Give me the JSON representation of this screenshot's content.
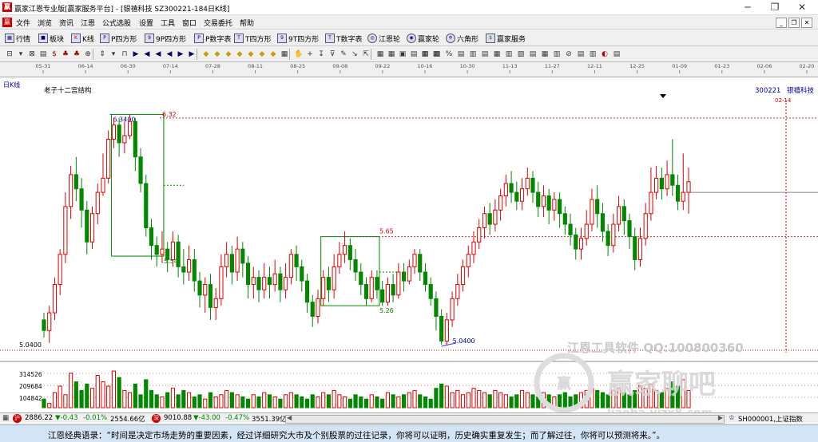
{
  "window": {
    "title": "赢家江恩专业版[赢家服务平台] - [银禧科技  SZ300221-184日K线]",
    "logo": "赢"
  },
  "menu": [
    "文件",
    "浏览",
    "资讯",
    "江恩",
    "公式选股",
    "设置",
    "工具",
    "窗口",
    "交易委托",
    "帮助"
  ],
  "toolbar1": [
    {
      "label": "行情",
      "icon": "grid-icon"
    },
    {
      "label": "板块",
      "icon": "block-icon"
    },
    {
      "label": "K线",
      "icon": "kline-icon"
    },
    {
      "label": "P四方形",
      "icon": "p-square-icon"
    },
    {
      "label": "9P四方形",
      "icon": "9p-square-icon"
    },
    {
      "label": "P数字表",
      "icon": "p-number-table-icon"
    },
    {
      "label": "T四方形",
      "icon": "t-square-icon"
    },
    {
      "label": "9T四方形",
      "icon": "9t-square-icon"
    },
    {
      "label": "T数字表",
      "icon": "t-number-table-icon"
    },
    {
      "label": "江恩轮",
      "icon": "gann-wheel-icon"
    },
    {
      "label": "赢家轮",
      "icon": "winner-wheel-icon"
    },
    {
      "label": "六角形",
      "icon": "hexagon-icon"
    },
    {
      "label": "赢家服务",
      "icon": "dollar-icon"
    }
  ],
  "period_label": "日K线",
  "date_ticks": [
    "05-31",
    "06-14",
    "06-30",
    "07-14",
    "07-28",
    "08-11",
    "08-25",
    "09-08",
    "09-22",
    "10-16",
    "10-30",
    "11-13",
    "11-27",
    "12-11",
    "12-25",
    "01-09",
    "01-23",
    "02-06",
    "02-20"
  ],
  "indicator_label": "老子十二宫结构",
  "stock": {
    "code": "300221",
    "name": "银禧科技",
    "last_date": "02-14"
  },
  "price_labels": {
    "high_box_top": "6.3400",
    "high_line": "6.32",
    "box1_bottom": "5.54",
    "box2_top": "5.65",
    "box2_bottom": "5.26",
    "low": "5.0400",
    "axis_low": "5.0400"
  },
  "volume_axis": [
    "314526",
    "209684",
    "104842"
  ],
  "watermark": {
    "line1": "江恩工具软件  QQ:100800360",
    "line2": "赢家聊吧",
    "line3": "liaoba.yjzx8.com",
    "badge": "赢"
  },
  "status": {
    "sh_index": "2886.22",
    "sh_change": "▼-0.43",
    "sh_pct": "-0.01%",
    "sh_amount": "2554.66亿",
    "sz_index": "9010.88",
    "sz_change": "▼-43.00",
    "sz_pct": "-0.47%",
    "sz_amount": "3551.39亿",
    "index_code": "SH000001,上证指数",
    "badge1": "沪",
    "badge2": "深"
  },
  "quote": "江恩经典语录：“时间是决定市场走势的重要因素，经过详细研究大市及个别股票的过往记录，你将可以证明，历史确实重复发生；而了解过往，你将可以预测将来。”。",
  "chart_data": {
    "type": "candlestick",
    "y_price_range": [
      4.95,
      6.45
    ],
    "candles": [
      [
        5.18,
        5.12,
        5.22,
        5.08
      ],
      [
        5.12,
        5.22,
        5.26,
        5.05
      ],
      [
        5.22,
        5.38,
        5.42,
        5.18
      ],
      [
        5.38,
        5.55,
        5.58,
        5.32
      ],
      [
        5.55,
        5.82,
        5.9,
        5.5
      ],
      [
        5.82,
        6.0,
        6.05,
        5.75
      ],
      [
        6.0,
        5.92,
        6.1,
        5.85
      ],
      [
        5.92,
        5.8,
        5.98,
        5.7
      ],
      [
        5.8,
        5.62,
        5.85,
        5.55
      ],
      [
        5.62,
        5.78,
        5.82,
        5.58
      ],
      [
        5.78,
        5.9,
        5.95,
        5.72
      ],
      [
        5.9,
        5.98,
        6.12,
        5.88
      ],
      [
        5.98,
        6.2,
        6.25,
        5.95
      ],
      [
        6.2,
        6.28,
        6.32,
        6.15
      ],
      [
        6.28,
        6.18,
        6.32,
        6.1
      ],
      [
        6.18,
        6.22,
        6.3,
        6.12
      ],
      [
        6.22,
        6.3,
        6.34,
        6.2
      ],
      [
        6.3,
        6.1,
        6.32,
        6.02
      ],
      [
        6.1,
        5.95,
        6.15,
        5.9
      ],
      [
        5.95,
        5.7,
        6.0,
        5.65
      ],
      [
        5.7,
        5.6,
        5.75,
        5.52
      ],
      [
        5.6,
        5.55,
        5.65,
        5.48
      ],
      [
        5.55,
        5.58,
        5.68,
        5.5
      ],
      [
        5.58,
        5.52,
        5.62,
        5.45
      ],
      [
        5.52,
        5.62,
        5.68,
        5.48
      ],
      [
        5.62,
        5.48,
        5.66,
        5.42
      ],
      [
        5.48,
        5.45,
        5.58,
        5.38
      ],
      [
        5.45,
        5.52,
        5.6,
        5.4
      ],
      [
        5.52,
        5.4,
        5.58,
        5.34
      ],
      [
        5.4,
        5.32,
        5.45,
        5.25
      ],
      [
        5.32,
        5.38,
        5.42,
        5.22
      ],
      [
        5.38,
        5.25,
        5.44,
        5.18
      ],
      [
        5.25,
        5.3,
        5.36,
        5.18
      ],
      [
        5.3,
        5.48,
        5.55,
        5.26
      ],
      [
        5.48,
        5.55,
        5.62,
        5.42
      ],
      [
        5.55,
        5.45,
        5.6,
        5.38
      ],
      [
        5.45,
        5.58,
        5.65,
        5.4
      ],
      [
        5.58,
        5.5,
        5.62,
        5.42
      ],
      [
        5.5,
        5.38,
        5.54,
        5.3
      ],
      [
        5.38,
        5.42,
        5.48,
        5.3
      ],
      [
        5.42,
        5.35,
        5.46,
        5.28
      ],
      [
        5.35,
        5.42,
        5.5,
        5.3
      ],
      [
        5.42,
        5.38,
        5.48,
        5.3
      ],
      [
        5.38,
        5.44,
        5.52,
        5.34
      ],
      [
        5.44,
        5.35,
        5.48,
        5.28
      ],
      [
        5.35,
        5.42,
        5.5,
        5.3
      ],
      [
        5.42,
        5.55,
        5.58,
        5.38
      ],
      [
        5.55,
        5.48,
        5.6,
        5.4
      ],
      [
        5.48,
        5.4,
        5.52,
        5.34
      ],
      [
        5.4,
        5.28,
        5.44,
        5.22
      ],
      [
        5.28,
        5.2,
        5.32,
        5.14
      ],
      [
        5.2,
        5.3,
        5.35,
        5.16
      ],
      [
        5.3,
        5.42,
        5.46,
        5.26
      ],
      [
        5.42,
        5.35,
        5.48,
        5.28
      ],
      [
        5.35,
        5.48,
        5.55,
        5.3
      ],
      [
        5.48,
        5.55,
        5.62,
        5.44
      ],
      [
        5.55,
        5.6,
        5.68,
        5.5
      ],
      [
        5.6,
        5.52,
        5.64,
        5.46
      ],
      [
        5.52,
        5.45,
        5.58,
        5.4
      ],
      [
        5.45,
        5.38,
        5.5,
        5.32
      ],
      [
        5.38,
        5.3,
        5.42,
        5.26
      ],
      [
        5.3,
        5.42,
        5.46,
        5.28
      ],
      [
        5.42,
        5.35,
        5.46,
        5.3
      ],
      [
        5.35,
        5.28,
        5.4,
        5.26
      ],
      [
        5.28,
        5.38,
        5.42,
        5.26
      ],
      [
        5.38,
        5.32,
        5.44,
        5.28
      ],
      [
        5.32,
        5.45,
        5.5,
        5.3
      ],
      [
        5.45,
        5.4,
        5.5,
        5.34
      ],
      [
        5.4,
        5.48,
        5.52,
        5.38
      ],
      [
        5.48,
        5.55,
        5.58,
        5.44
      ],
      [
        5.55,
        5.45,
        5.58,
        5.4
      ],
      [
        5.45,
        5.38,
        5.5,
        5.34
      ],
      [
        5.38,
        5.3,
        5.42,
        5.26
      ],
      [
        5.3,
        5.2,
        5.34,
        5.12
      ],
      [
        5.2,
        5.06,
        5.24,
        5.04
      ],
      [
        5.06,
        5.18,
        5.22,
        5.04
      ],
      [
        5.18,
        5.3,
        5.34,
        5.14
      ],
      [
        5.3,
        5.38,
        5.44,
        5.26
      ],
      [
        5.38,
        5.48,
        5.52,
        5.34
      ],
      [
        5.48,
        5.55,
        5.6,
        5.42
      ],
      [
        5.55,
        5.62,
        5.68,
        5.5
      ],
      [
        5.62,
        5.7,
        5.75,
        5.58
      ],
      [
        5.7,
        5.78,
        5.82,
        5.64
      ],
      [
        5.78,
        5.72,
        5.84,
        5.66
      ],
      [
        5.72,
        5.8,
        5.86,
        5.68
      ],
      [
        5.8,
        5.88,
        5.92,
        5.74
      ],
      [
        5.88,
        5.95,
        6.0,
        5.82
      ],
      [
        5.95,
        5.9,
        6.02,
        5.84
      ],
      [
        5.9,
        5.85,
        5.96,
        5.8
      ],
      [
        5.85,
        5.92,
        5.98,
        5.8
      ],
      [
        5.92,
        5.98,
        6.04,
        5.88
      ],
      [
        5.98,
        5.9,
        6.02,
        5.84
      ],
      [
        5.9,
        5.82,
        5.96,
        5.76
      ],
      [
        5.82,
        5.88,
        5.94,
        5.76
      ],
      [
        5.88,
        5.8,
        5.92,
        5.72
      ],
      [
        5.8,
        5.86,
        5.9,
        5.74
      ],
      [
        5.86,
        5.78,
        5.9,
        5.7
      ],
      [
        5.78,
        5.72,
        5.82,
        5.66
      ],
      [
        5.72,
        5.66,
        5.78,
        5.6
      ],
      [
        5.66,
        5.58,
        5.7,
        5.52
      ],
      [
        5.58,
        5.64,
        5.7,
        5.52
      ],
      [
        5.64,
        5.72,
        5.8,
        5.6
      ],
      [
        5.72,
        5.86,
        5.92,
        5.68
      ],
      [
        5.86,
        5.78,
        5.94,
        5.7
      ],
      [
        5.78,
        5.68,
        5.84,
        5.62
      ],
      [
        5.68,
        5.6,
        5.72,
        5.54
      ],
      [
        5.6,
        5.72,
        5.78,
        5.56
      ],
      [
        5.72,
        5.82,
        5.88,
        5.68
      ],
      [
        5.82,
        5.74,
        5.86,
        5.66
      ],
      [
        5.74,
        5.65,
        5.78,
        5.58
      ],
      [
        5.65,
        5.52,
        5.7,
        5.46
      ],
      [
        5.52,
        5.64,
        5.7,
        5.48
      ],
      [
        5.64,
        5.78,
        5.84,
        5.6
      ],
      [
        5.78,
        5.9,
        6.04,
        5.74
      ],
      [
        5.9,
        5.98,
        6.05,
        5.86
      ],
      [
        5.98,
        5.92,
        6.04,
        5.86
      ],
      [
        5.92,
        6.0,
        6.08,
        5.88
      ],
      [
        6.0,
        5.94,
        6.2,
        5.88
      ],
      [
        5.94,
        5.85,
        6.0,
        5.8
      ],
      [
        5.85,
        5.9,
        6.12,
        5.8
      ],
      [
        5.9,
        5.96,
        6.04,
        5.78
      ]
    ],
    "volumes": [
      0.2,
      0.1,
      0.35,
      0.5,
      0.3,
      0.8,
      0.6,
      0.4,
      0.55,
      0.45,
      0.75,
      0.6,
      0.5,
      0.85,
      0.7,
      0.4,
      0.35,
      0.55,
      0.3,
      0.65,
      0.4,
      0.3,
      0.25,
      0.35,
      0.45,
      0.3,
      0.4,
      0.35,
      0.25,
      0.3,
      0.2,
      0.35,
      0.25,
      0.3,
      0.4,
      0.35,
      0.3,
      0.25,
      0.2,
      0.3,
      0.25,
      0.35,
      0.3,
      0.25,
      0.2,
      0.3,
      0.35,
      0.3,
      0.25,
      0.2,
      0.3,
      0.25,
      0.35,
      0.3,
      0.4,
      0.3,
      0.25,
      0.2,
      0.3,
      0.25,
      0.2,
      0.3,
      0.25,
      0.2,
      0.35,
      0.3,
      0.25,
      0.3,
      0.35,
      0.4,
      0.3,
      0.25,
      0.2,
      0.45,
      0.55,
      0.5,
      0.35,
      0.4,
      0.3,
      0.35,
      0.45,
      0.4,
      0.35,
      0.3,
      0.4,
      0.35,
      0.3,
      0.25,
      0.3,
      0.4,
      0.35,
      0.3,
      0.25,
      0.35,
      0.3,
      0.25,
      0.3,
      0.35,
      0.25,
      0.3,
      0.35,
      0.4,
      0.45,
      0.4,
      0.35,
      0.3,
      0.4,
      0.45,
      0.35,
      0.3,
      0.4,
      0.5,
      0.45,
      0.55,
      0.4,
      0.35,
      0.45,
      0.6,
      0.5,
      0.65,
      0.4
    ]
  }
}
